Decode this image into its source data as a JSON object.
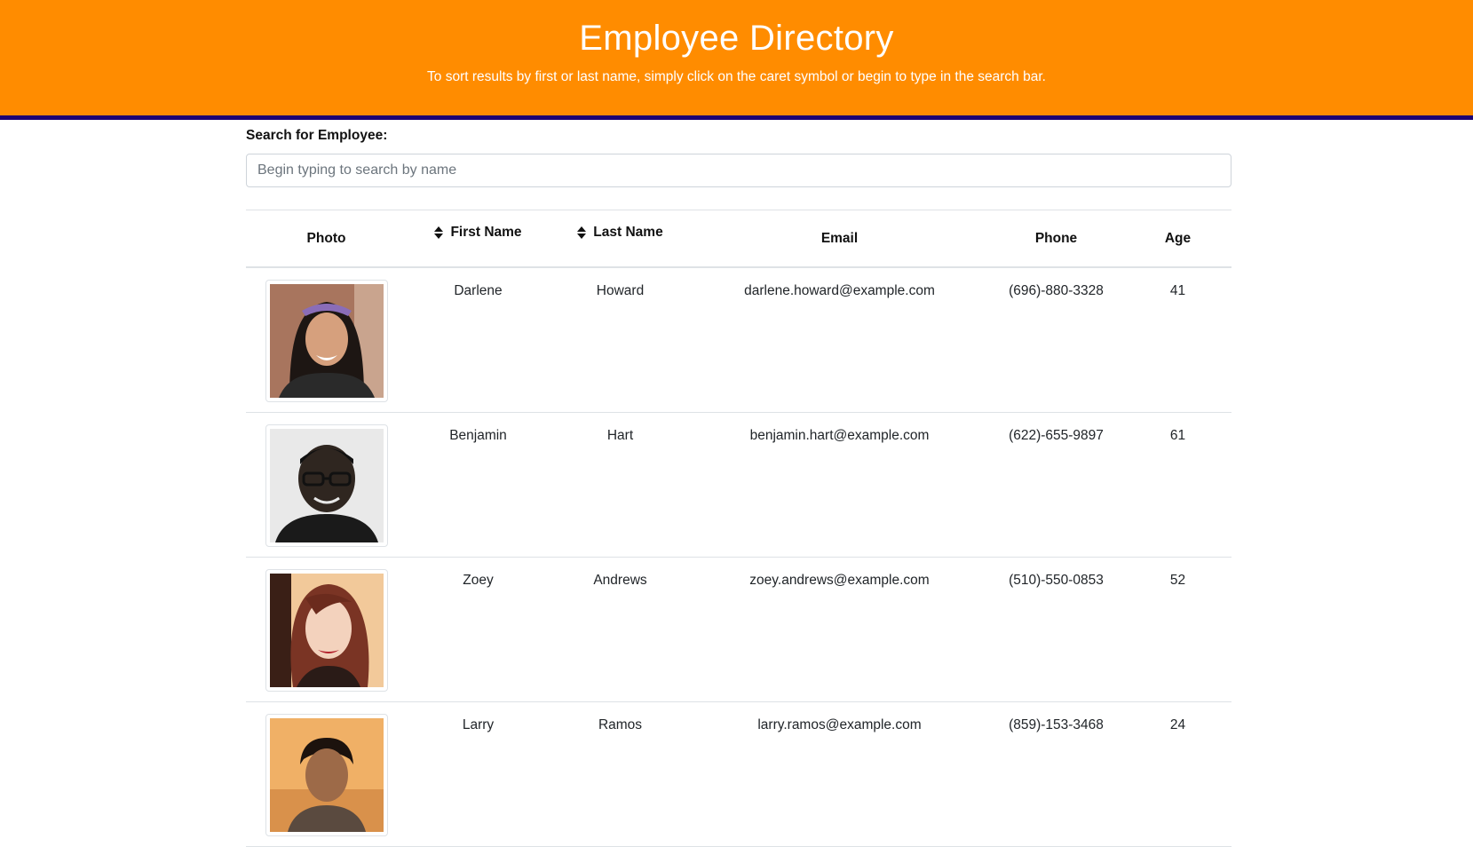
{
  "header": {
    "title": "Employee Directory",
    "subtitle": "To sort results by first or last name, simply click on the caret symbol or begin to type in the search bar."
  },
  "search": {
    "label": "Search for Employee:",
    "placeholder": "Begin typing to search by name",
    "value": ""
  },
  "colors": {
    "header_bg": "#ff8c00",
    "header_rule": "#1c0473"
  },
  "table": {
    "columns": {
      "photo": "Photo",
      "first_name": "First Name",
      "last_name": "Last Name",
      "email": "Email",
      "phone": "Phone",
      "age": "Age"
    },
    "sort_icon": "sort-caret-icon",
    "rows": [
      {
        "first": "Darlene",
        "last": "Howard",
        "email": "darlene.howard@example.com",
        "phone": "(696)-880-3328",
        "age": "41"
      },
      {
        "first": "Benjamin",
        "last": "Hart",
        "email": "benjamin.hart@example.com",
        "phone": "(622)-655-9897",
        "age": "61"
      },
      {
        "first": "Zoey",
        "last": "Andrews",
        "email": "zoey.andrews@example.com",
        "phone": "(510)-550-0853",
        "age": "52"
      },
      {
        "first": "Larry",
        "last": "Ramos",
        "email": "larry.ramos@example.com",
        "phone": "(859)-153-3468",
        "age": "24"
      }
    ]
  }
}
